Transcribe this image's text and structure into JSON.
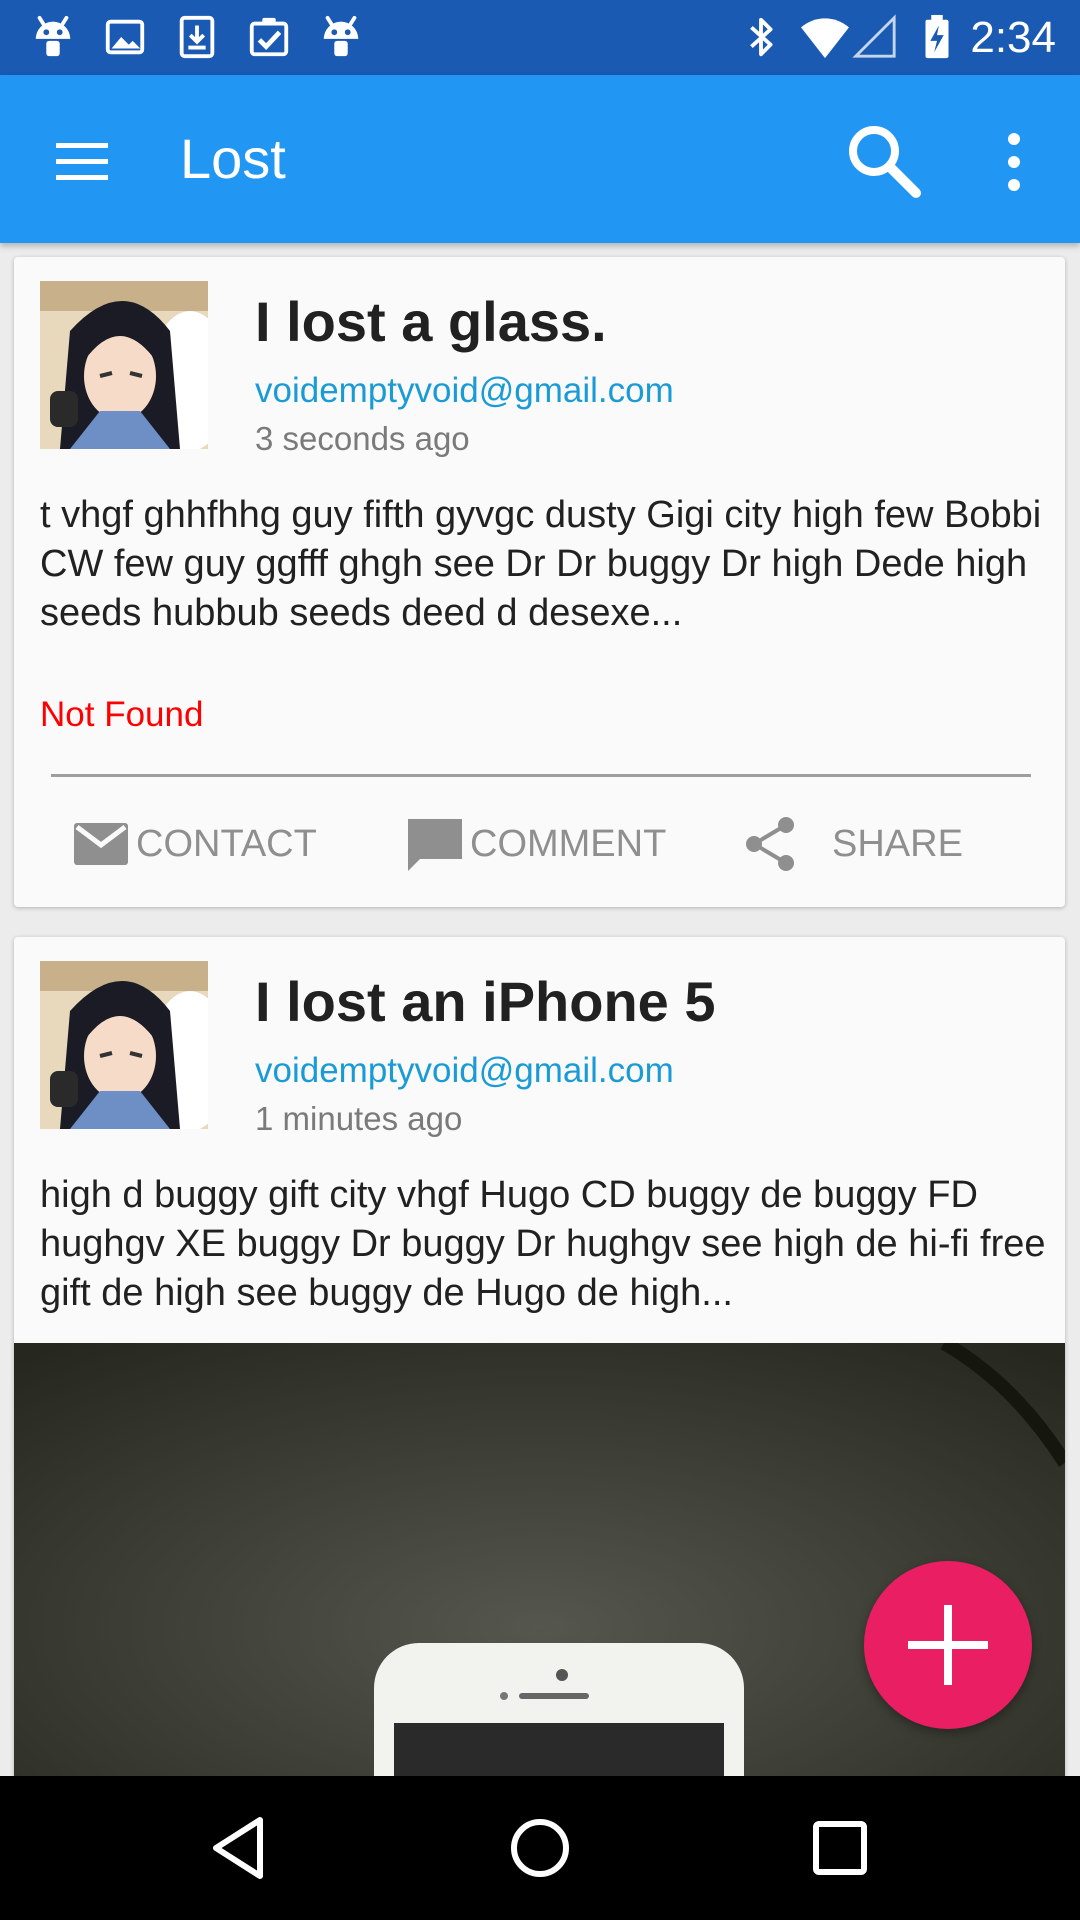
{
  "status_bar": {
    "time": "2:34",
    "icons": [
      "android-icon",
      "image-icon",
      "download-icon",
      "clipboard-check-icon",
      "android-icon",
      "bluetooth-icon",
      "wifi-icon",
      "cell-signal-icon",
      "battery-charging-icon"
    ]
  },
  "app_bar": {
    "title": "Lost",
    "icons": [
      "menu-icon",
      "search-icon",
      "overflow-icon"
    ],
    "color": "#2196f3"
  },
  "posts": [
    {
      "title": "I lost a glass.",
      "email": "voidemptyvoid@gmail.com",
      "time": "3 seconds ago",
      "body": "t vhgf ghhfhhg guy fifth gyvgc dusty Gigi city high few Bobbi CW few guy ggfff ghgh see Dr Dr buggy Dr high Dede high seeds hubbub seeds deed d desexe...",
      "status": "Not Found",
      "actions": {
        "contact": "CONTACT",
        "comment": "COMMENT",
        "share": "SHARE"
      }
    },
    {
      "title": "I lost an iPhone 5",
      "email": "voidemptyvoid@gmail.com",
      "time": "1 minutes ago",
      "body": "high d buggy gift city vhgf Hugo CD buggy de buggy FD hughgv XE buggy Dr buggy Dr hughgv see high de hi-fi free gift de high see buggy de Hugo de high..."
    }
  ],
  "fab": {
    "icon": "plus-icon",
    "color": "#e91e63"
  },
  "nav_bar": {
    "icons": [
      "back-icon",
      "home-icon",
      "recents-icon"
    ]
  },
  "colors": {
    "status_bar": "#1a5ab3",
    "link": "#1a9bd6",
    "status_text": "#ff0000"
  }
}
